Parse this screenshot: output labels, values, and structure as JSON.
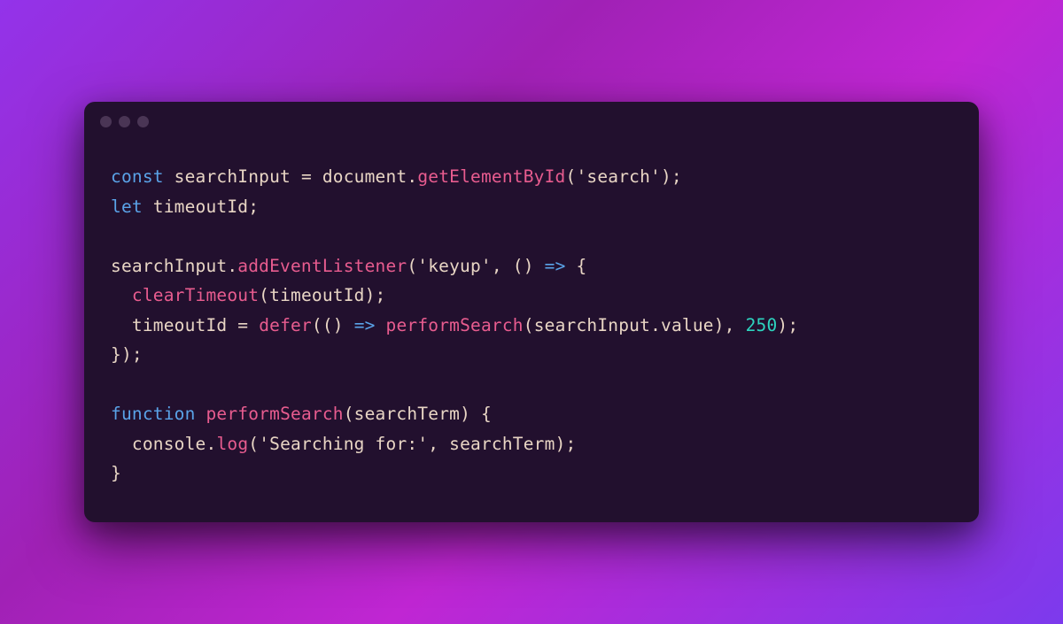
{
  "colors": {
    "background_gradient_start": "#9333ea",
    "background_gradient_end": "#7c3aed",
    "window_bg": "#22102e",
    "traffic_light": "#4a3555",
    "keyword": "#5aa3e8",
    "method": "#e85c8f",
    "number": "#2dd4bf",
    "text": "#e8d5c4"
  },
  "code": {
    "line1": {
      "kw_const": "const",
      "var_searchInput": "searchInput",
      "op_eq": " = ",
      "obj_document": "document",
      "dot1": ".",
      "method_getElementById": "getElementById",
      "paren_open": "(",
      "str_search": "'search'",
      "paren_close_semi": ");"
    },
    "line2": {
      "kw_let": "let",
      "var_timeoutId": "timeoutId",
      "semi": ";"
    },
    "line3": "",
    "line4": {
      "var_searchInput": "searchInput",
      "dot": ".",
      "method_addEventListener": "addEventListener",
      "paren_open": "(",
      "str_keyup": "'keyup'",
      "comma_sp": ", ",
      "arrow_params": "()",
      "sp": " ",
      "arrow": "=>",
      "sp2": " ",
      "brace_open": "{"
    },
    "line5": {
      "indent": "  ",
      "func_clearTimeout": "clearTimeout",
      "paren_open": "(",
      "var_timeoutId": "timeoutId",
      "paren_close_semi": ");"
    },
    "line6": {
      "indent": "  ",
      "var_timeoutId": "timeoutId",
      "op_eq": " = ",
      "func_defer": "defer",
      "paren_open": "(",
      "arrow_params": "()",
      "sp": " ",
      "arrow": "=>",
      "sp2": " ",
      "func_performSearch": "performSearch",
      "paren_open2": "(",
      "var_searchInput": "searchInput",
      "dot": ".",
      "prop_value": "value",
      "paren_close": ")",
      "comma_sp": ", ",
      "num_250": "250",
      "paren_close_semi": ");"
    },
    "line7": {
      "brace_close_paren_semi": "});"
    },
    "line8": "",
    "line9": {
      "kw_function": "function",
      "sp": " ",
      "func_performSearch": "performSearch",
      "paren_open": "(",
      "param_searchTerm": "searchTerm",
      "paren_close_sp": ") ",
      "brace_open": "{"
    },
    "line10": {
      "indent": "  ",
      "obj_console": "console",
      "dot": ".",
      "method_log": "log",
      "paren_open": "(",
      "str_searching": "'Searching for:'",
      "comma_sp": ", ",
      "var_searchTerm": "searchTerm",
      "paren_close_semi": ");"
    },
    "line11": {
      "brace_close": "}"
    }
  }
}
